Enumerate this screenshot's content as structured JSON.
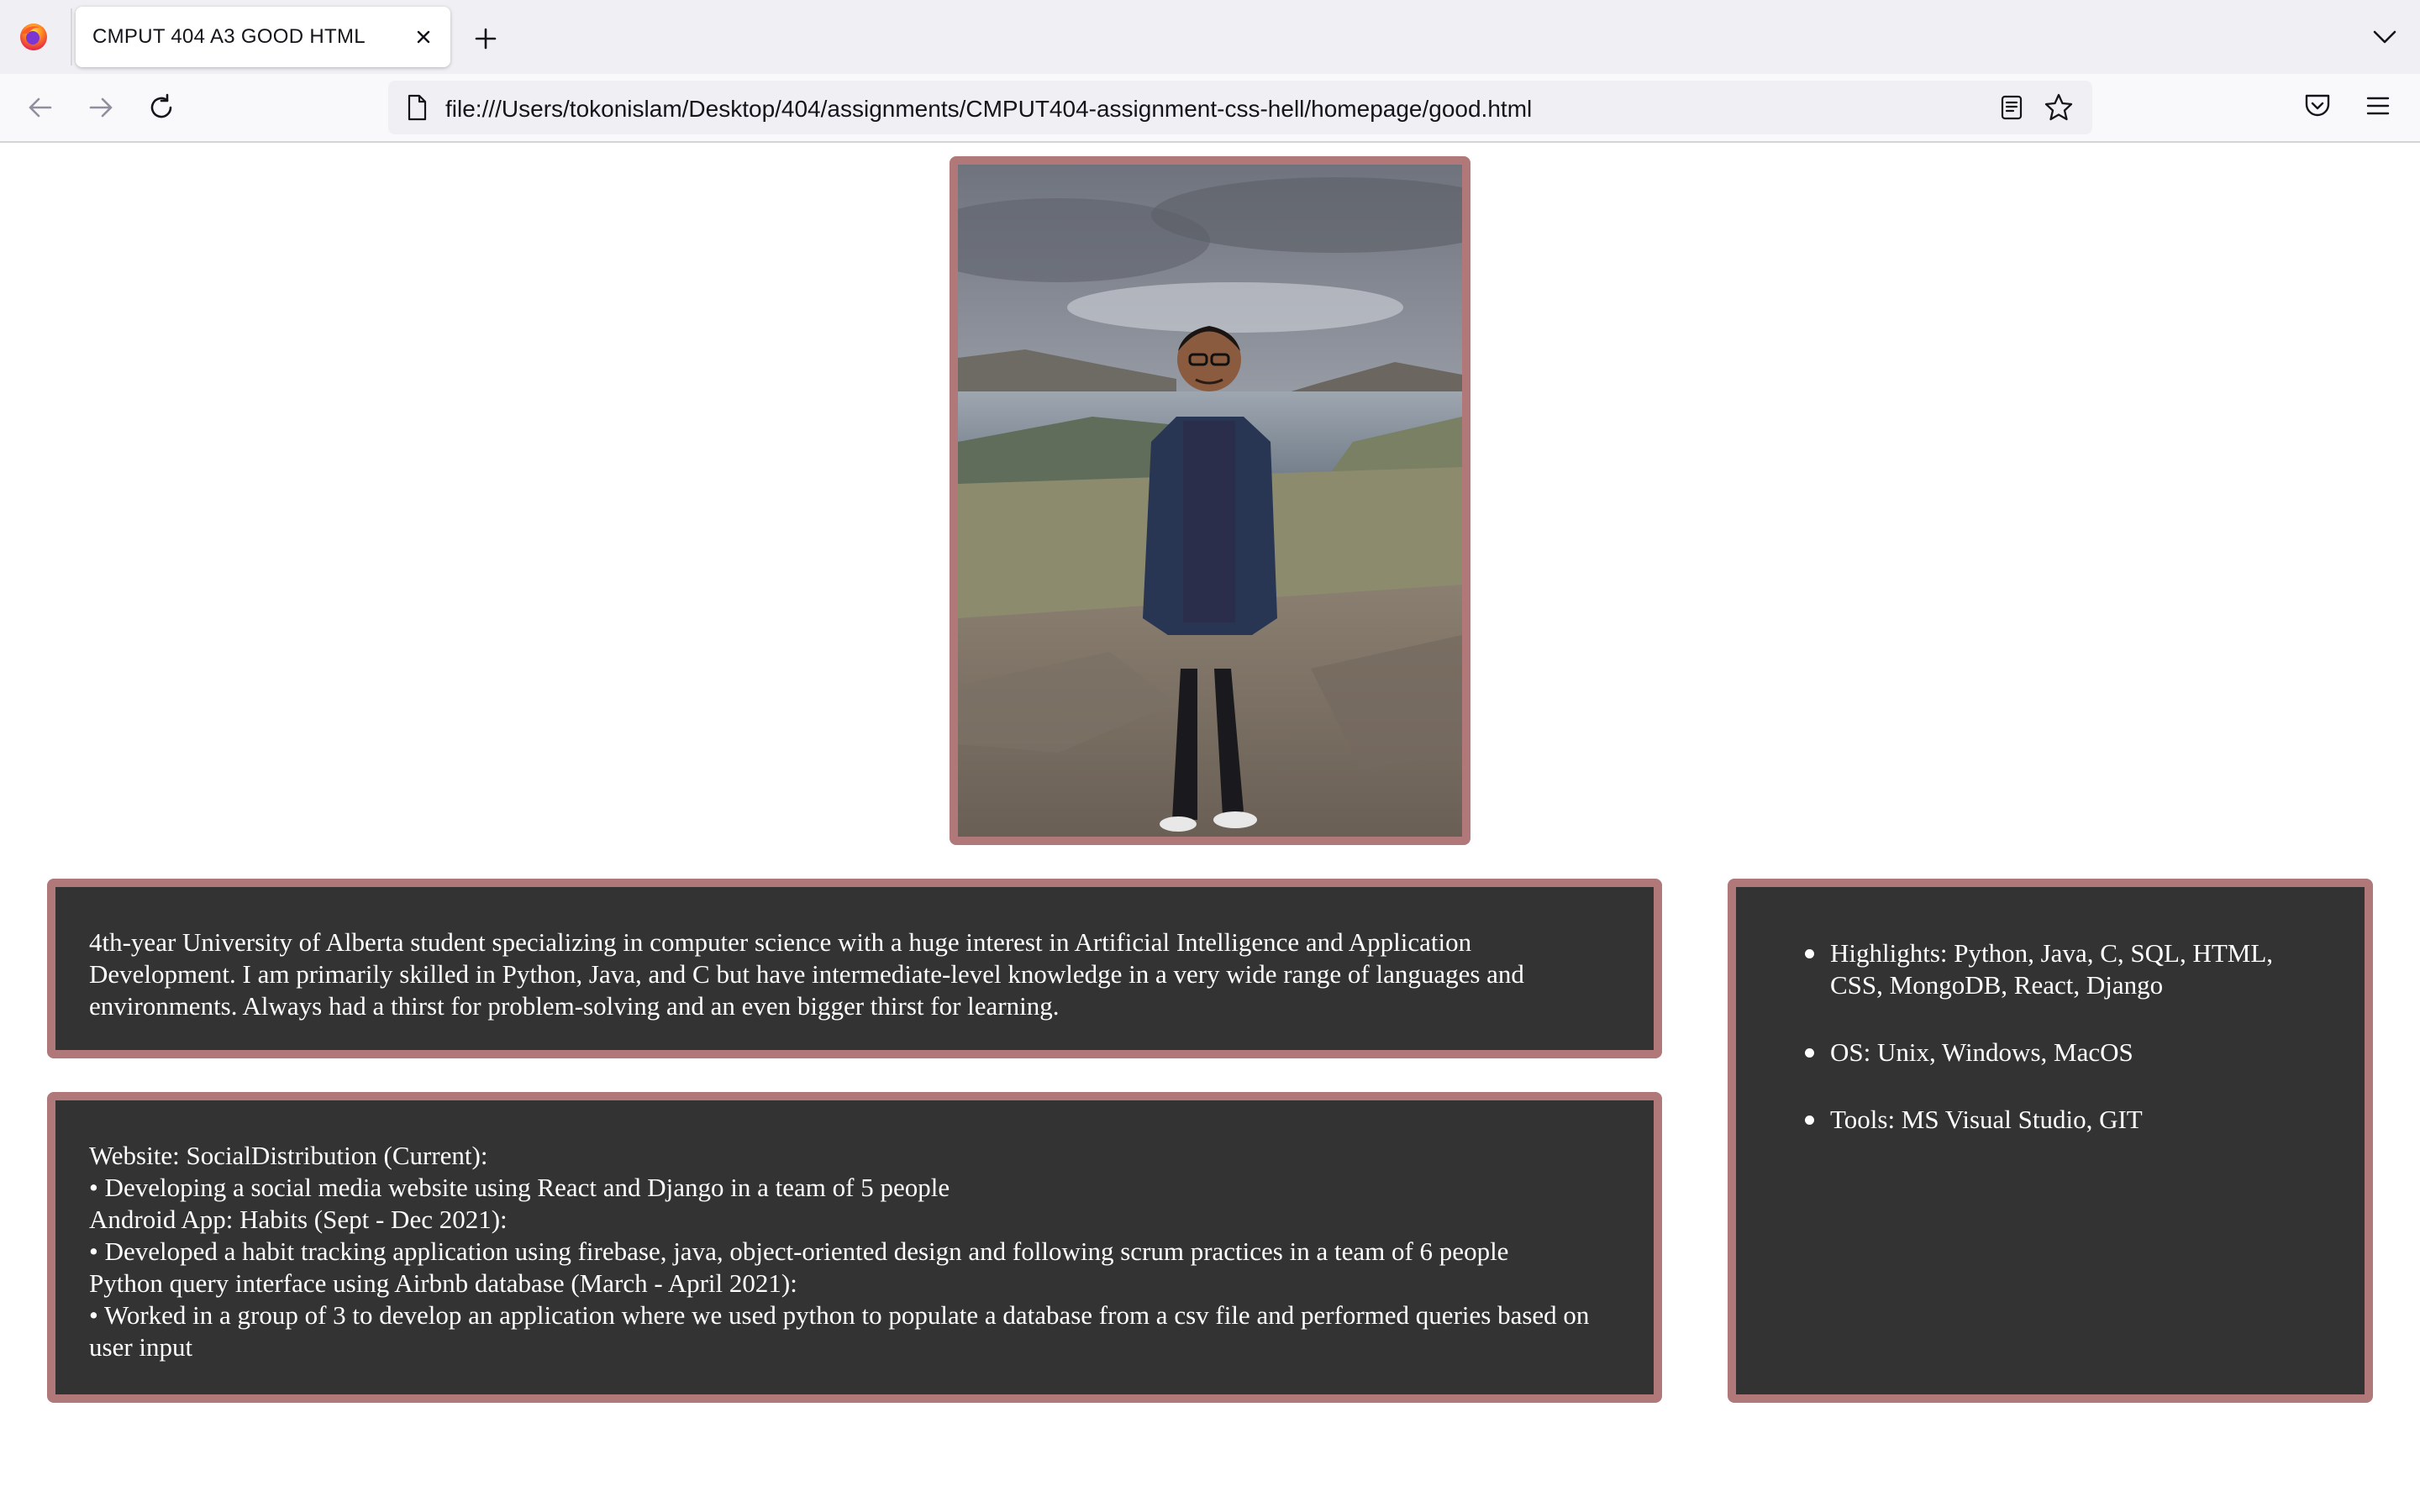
{
  "browser": {
    "tab_title": "CMPUT 404 A3 GOOD HTML",
    "url": "file:///Users/tokonislam/Desktop/404/assignments/CMPUT404-assignment-css-hell/homepage/good.html",
    "icons": [
      "firefox-logo",
      "close-icon",
      "plus-icon",
      "chevron-down-icon",
      "back-arrow-icon",
      "forward-arrow-icon",
      "reload-icon",
      "page-icon",
      "reader-view-icon",
      "star-icon",
      "pocket-icon",
      "hamburger-menu-icon"
    ]
  },
  "page": {
    "about": "4th-year University of Alberta student specializing in computer science with a huge interest in Artificial Intelligence and Application Development. I am primarily skilled in Python, Java, and C but have intermediate-level knowledge in a very wide range of languages and environments. Always had a thirst for problem-solving and an even bigger thirst for learning.",
    "projects": [
      "Website: SocialDistribution (Current):",
      "• Developing a social media website using React and Django in a team of 5 people",
      "Android App: Habits (Sept - Dec 2021):",
      "• Developed a habit tracking application using firebase, java, object-oriented design and following scrum practices in a team of 6 people",
      "Python query interface using Airbnb database (March - April 2021):",
      "• Worked in a group of 3 to develop an application where we used python to populate a database from a csv file and performed queries based on user input"
    ],
    "skills": [
      "Highlights: Python, Java, C, SQL, HTML, CSS, MongoDB, React, Django",
      "OS: Unix, Windows, MacOS",
      "Tools: MS Visual Studio, GIT"
    ],
    "colors": {
      "card_background": "#333333",
      "card_border": "#b07878",
      "card_text": "#ffffff"
    }
  }
}
